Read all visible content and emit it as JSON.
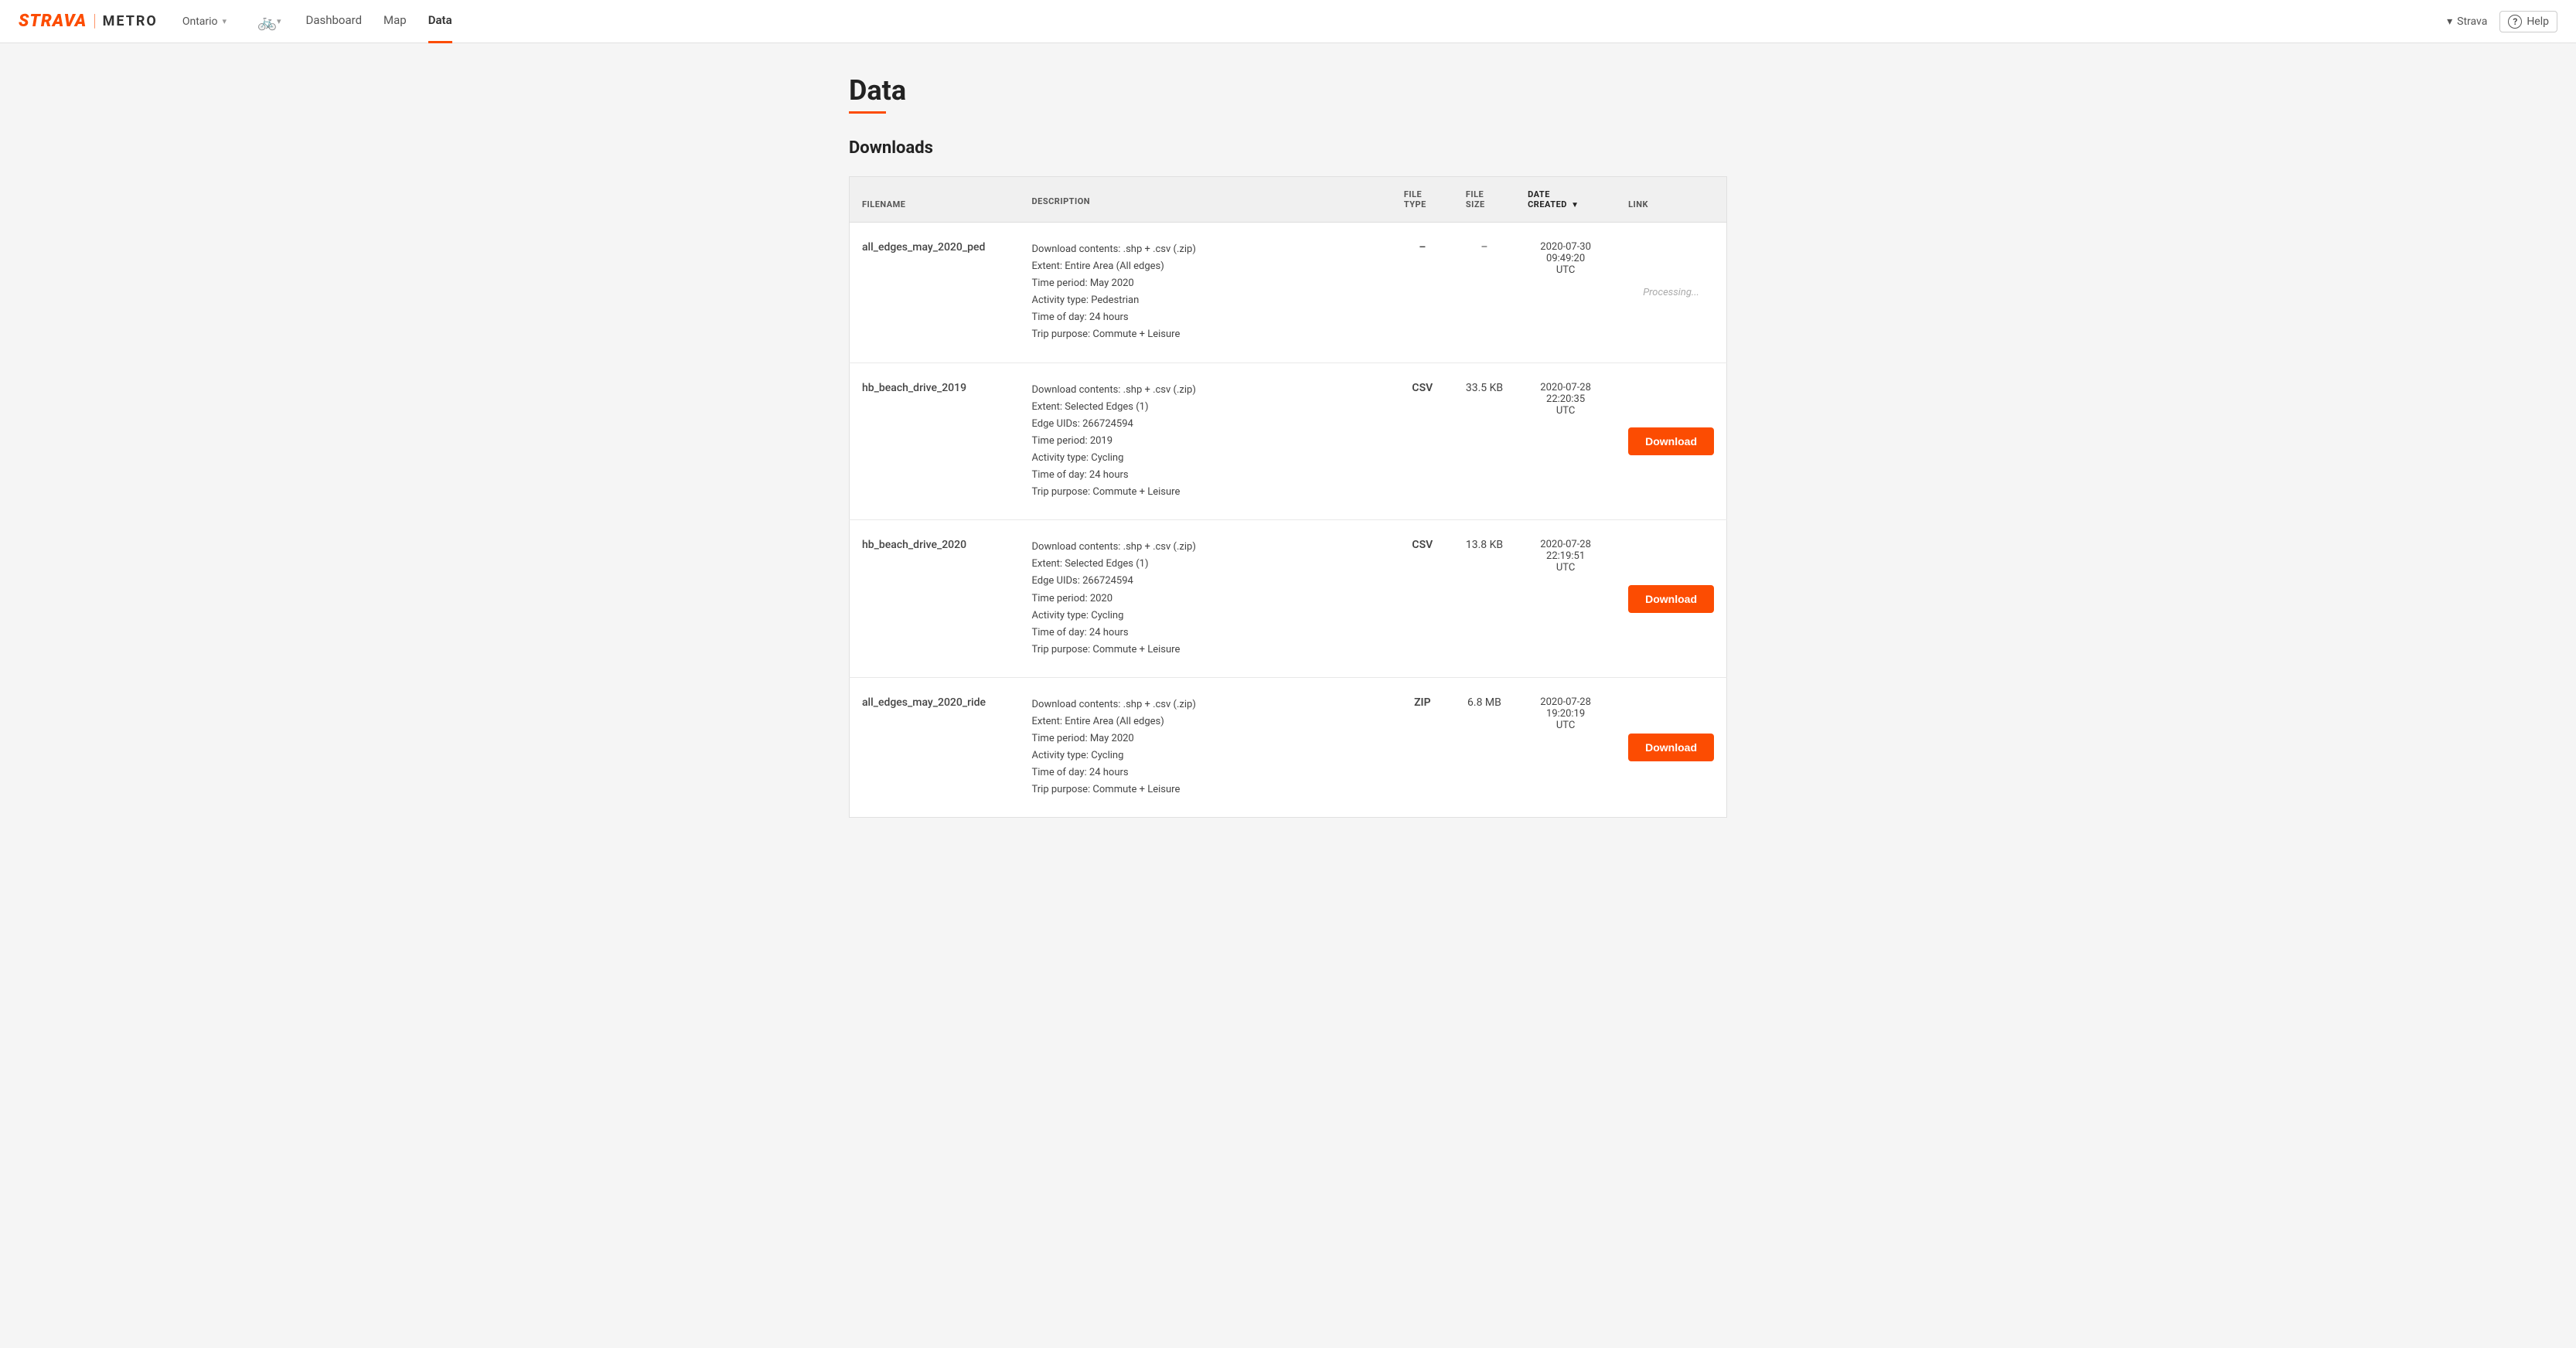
{
  "brand": {
    "strava": "STRAVA",
    "divider": "|",
    "metro": "METRO"
  },
  "nav": {
    "region": "Ontario",
    "links": [
      {
        "label": "Dashboard",
        "active": false
      },
      {
        "label": "Map",
        "active": false
      },
      {
        "label": "Data",
        "active": true
      }
    ],
    "account_chevron": "▾",
    "account_label": "Strava",
    "help_icon": "?",
    "help_label": "Help"
  },
  "page": {
    "title": "Data",
    "underline": true,
    "section_title": "Downloads"
  },
  "table": {
    "columns": [
      {
        "label": "FILENAME",
        "key": "filename",
        "sorted": false
      },
      {
        "label": "DESCRIPTION",
        "key": "description",
        "sorted": false
      },
      {
        "label": "FILE TYPE",
        "key": "filetype",
        "sorted": false
      },
      {
        "label": "FILE SIZE",
        "key": "filesize",
        "sorted": false
      },
      {
        "label": "DATE CREATED",
        "key": "datecreated",
        "sorted": true,
        "sort_arrow": "▼"
      },
      {
        "label": "LINK",
        "key": "link",
        "sorted": false
      }
    ],
    "rows": [
      {
        "filename": "all_edges_may_2020_ped",
        "description": "Download contents: .shp + .csv (.zip)\nExtent: Entire Area (All edges)\nTime period: May 2020\nActivity type: Pedestrian\nTime of day: 24 hours\nTrip purpose: Commute + Leisure",
        "filetype": "–",
        "filesize": "–",
        "datecreated": "2020-07-30\n09:49:20\nUTC",
        "link_type": "processing",
        "link_label": "Processing..."
      },
      {
        "filename": "hb_beach_drive_2019",
        "description": "Download contents: .shp + .csv (.zip)\nExtent: Selected Edges (1)\nEdge UIDs: 266724594\nTime period: 2019\nActivity type: Cycling\nTime of day: 24 hours\nTrip purpose: Commute + Leisure",
        "filetype": "CSV",
        "filesize": "33.5 KB",
        "datecreated": "2020-07-28\n22:20:35\nUTC",
        "link_type": "download",
        "link_label": "Download"
      },
      {
        "filename": "hb_beach_drive_2020",
        "description": "Download contents: .shp + .csv (.zip)\nExtent: Selected Edges (1)\nEdge UIDs: 266724594\nTime period: 2020\nActivity type: Cycling\nTime of day: 24 hours\nTrip purpose: Commute + Leisure",
        "filetype": "CSV",
        "filesize": "13.8 KB",
        "datecreated": "2020-07-28\n22:19:51\nUTC",
        "link_type": "download",
        "link_label": "Download"
      },
      {
        "filename": "all_edges_may_2020_ride",
        "description": "Download contents: .shp + .csv (.zip)\nExtent: Entire Area (All edges)\nTime period: May 2020\nActivity type: Cycling\nTime of day: 24 hours\nTrip purpose: Commute + Leisure",
        "filetype": "ZIP",
        "filesize": "6.8 MB",
        "datecreated": "2020-07-28\n19:20:19\nUTC",
        "link_type": "download",
        "link_label": "Download"
      }
    ]
  }
}
